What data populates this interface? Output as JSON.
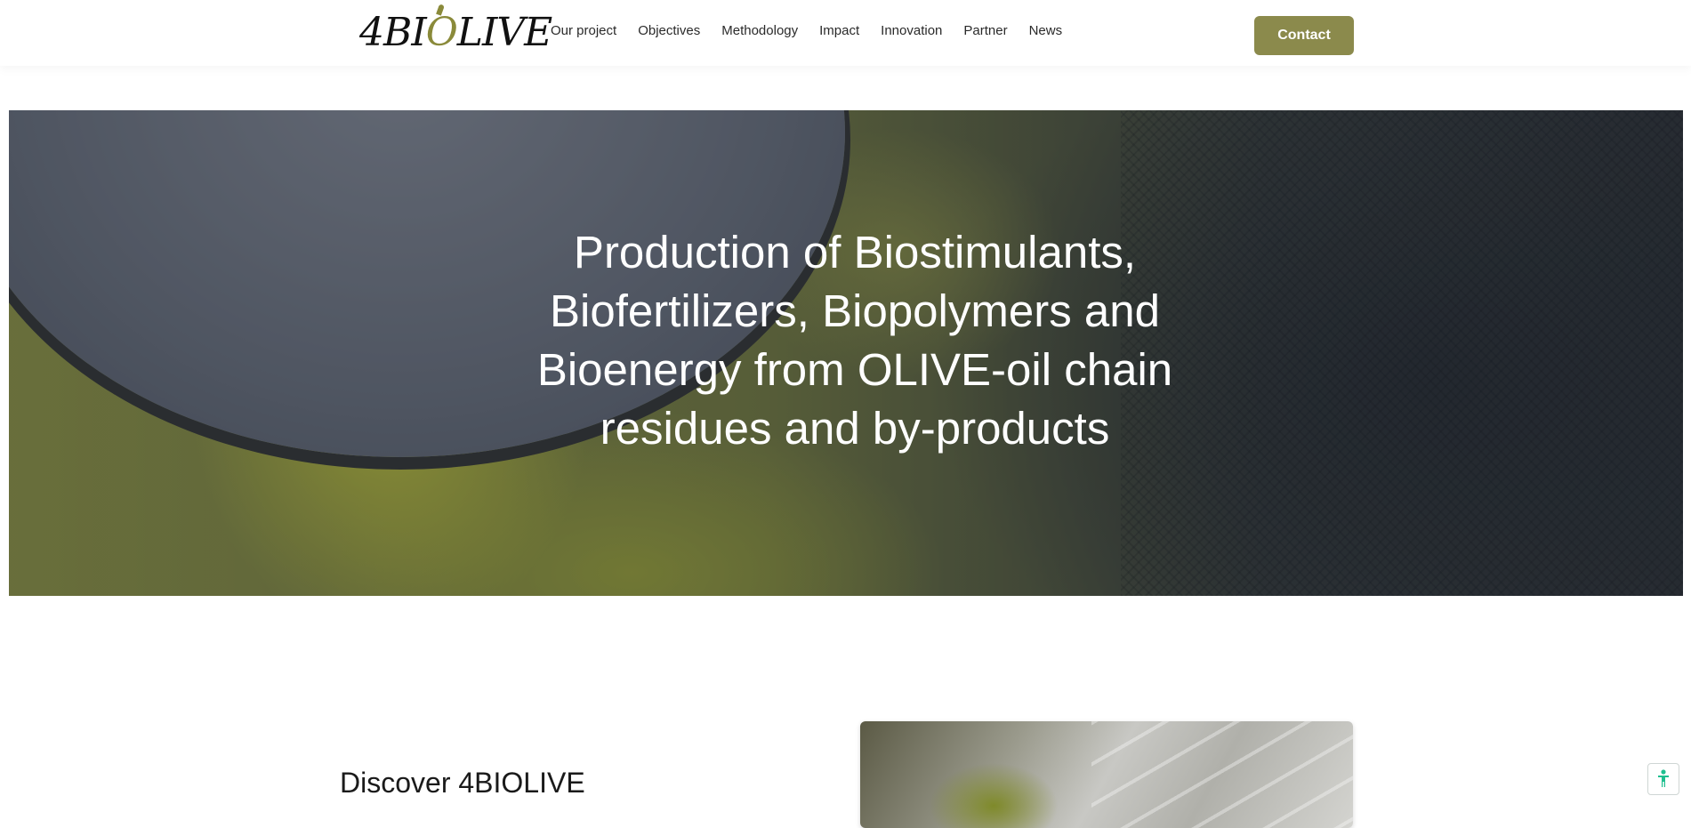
{
  "header": {
    "logo": {
      "prefix": "4BI",
      "o": "O",
      "suffix": "LIVE"
    },
    "nav": [
      {
        "label": "Our project"
      },
      {
        "label": "Objectives"
      },
      {
        "label": "Methodology"
      },
      {
        "label": "Impact"
      },
      {
        "label": "Innovation"
      },
      {
        "label": "Partner"
      },
      {
        "label": "News"
      }
    ],
    "contact_label": "Contact"
  },
  "hero": {
    "title": "Production of Biostimulants, Biofertilizers, Biopolymers and Bioenergy from OLIVE-oil chain residues and by-products"
  },
  "discover": {
    "title": "Discover 4BIOLIVE"
  },
  "colors": {
    "accent": "#8b8a4c",
    "hero_text": "#ffffff",
    "accessibility": "#1fbf8f"
  },
  "icons": {
    "accessibility": "person-icon"
  }
}
